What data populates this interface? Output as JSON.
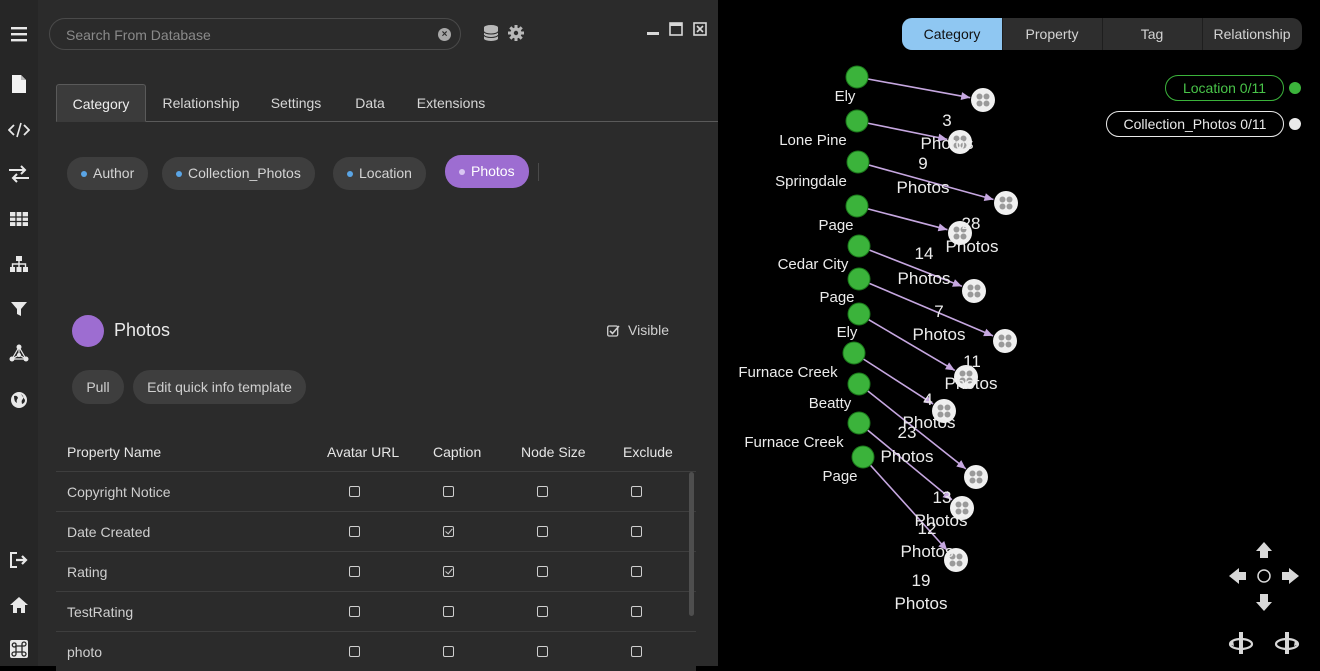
{
  "sidebar": {
    "icons": [
      "menu-icon",
      "document-icon",
      "code-icon",
      "swap-icon",
      "table-icon",
      "hierarchy-icon",
      "filter-icon",
      "network-icon",
      "globe-icon",
      "logout-icon",
      "home-icon",
      "command-icon"
    ]
  },
  "search": {
    "placeholder": "Search From Database"
  },
  "tabs": [
    "Category",
    "Relationship",
    "Settings",
    "Data",
    "Extensions"
  ],
  "categories": [
    "Author",
    "Collection_Photos",
    "Location",
    "Photos"
  ],
  "selected_category": {
    "name": "Photos",
    "visible_label": "Visible",
    "visible": true,
    "color": "#9d6dd1"
  },
  "actions": {
    "pull": "Pull",
    "edit_template": "Edit quick info template"
  },
  "table": {
    "headers": [
      "Property Name",
      "Avatar URL",
      "Caption",
      "Node Size",
      "Exclude"
    ],
    "rows": [
      {
        "name": "Copyright Notice",
        "avatar": false,
        "caption": false,
        "size": false,
        "exclude": false
      },
      {
        "name": "Date Created",
        "avatar": false,
        "caption": true,
        "size": false,
        "exclude": false
      },
      {
        "name": "Rating",
        "avatar": false,
        "caption": true,
        "size": false,
        "exclude": false
      },
      {
        "name": "TestRating",
        "avatar": false,
        "caption": false,
        "size": false,
        "exclude": false
      },
      {
        "name": "photo",
        "avatar": false,
        "caption": false,
        "size": false,
        "exclude": false
      }
    ]
  },
  "graph_view": {
    "modes": [
      "Category",
      "Property",
      "Tag",
      "Relationship"
    ],
    "active_mode": "Category",
    "legend": [
      {
        "label": "Location 0/11",
        "color": "#3bb33b"
      },
      {
        "label": "Collection_Photos 0/11",
        "color": "#eaeaea"
      }
    ],
    "location_labels": [
      "Ely",
      "Lone Pine",
      "Springdale",
      "Page",
      "Cedar City",
      "Page",
      "Ely",
      "Furnace Creek",
      "Beatty",
      "Furnace Creek",
      "Page"
    ],
    "photo_counts": [
      "3",
      "9",
      "28",
      "14",
      "7",
      "11",
      "4",
      "23",
      "13",
      "12",
      "19"
    ],
    "photo_word": "Photos"
  }
}
